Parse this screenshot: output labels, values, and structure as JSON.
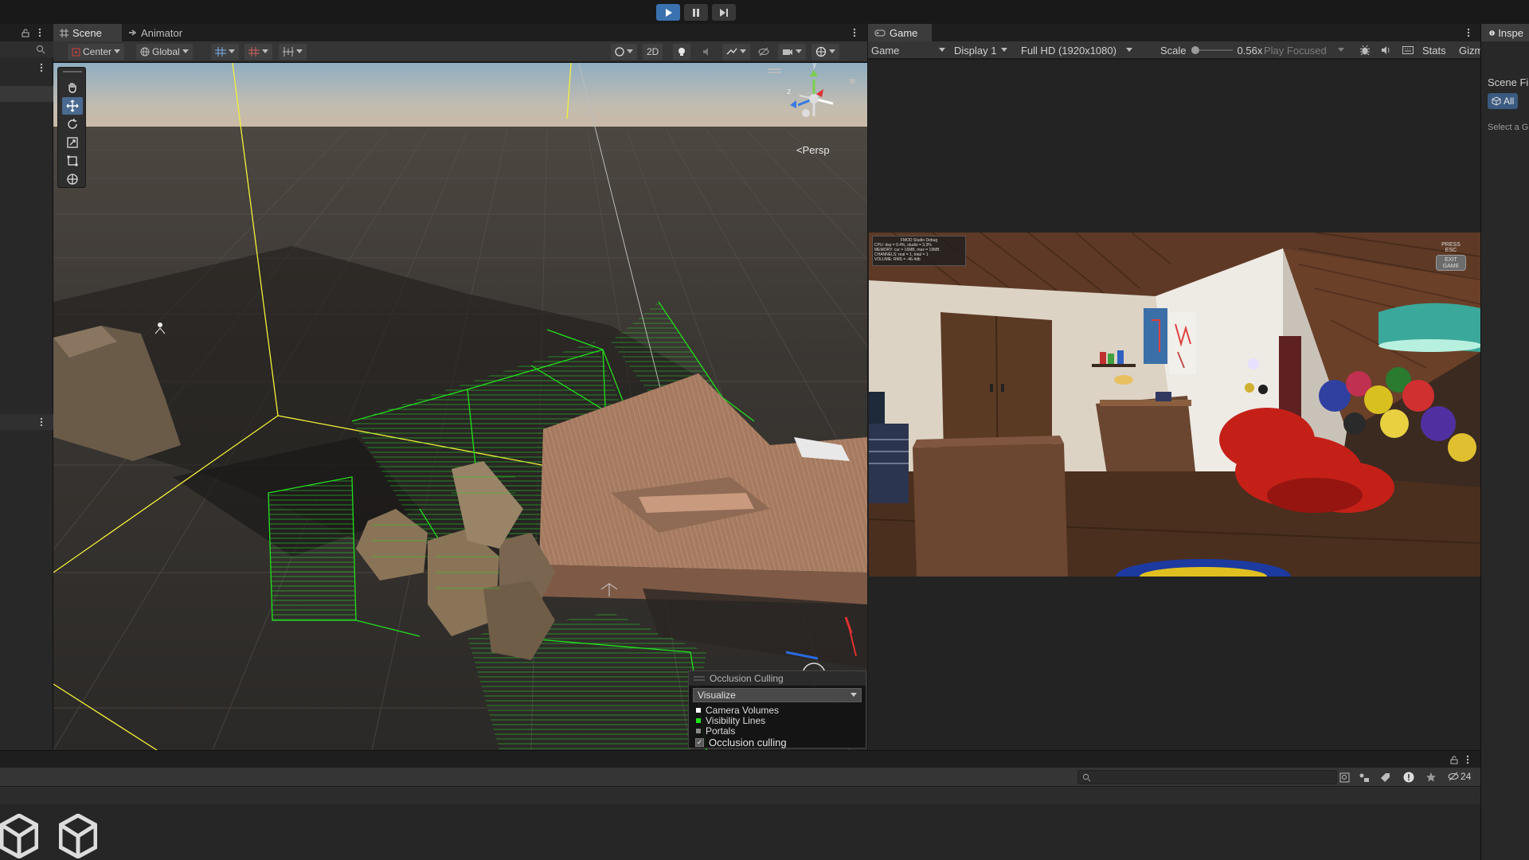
{
  "colors": {
    "accent_play": "#3a72b0",
    "panel": "#282828",
    "toolbar": "#353535",
    "tab_selected": "#3c3c3c",
    "culling_green": "#22e01d",
    "gizmo_yellow": "#f4f03a",
    "camera_volume_color": "#ffffff",
    "visibility_lines_color": "#22e01d",
    "portals_color": "#8a8a8a"
  },
  "playbar": {
    "play_icon": "play-icon",
    "pause_icon": "pause-icon",
    "step_icon": "step-icon"
  },
  "scene_panel": {
    "tabs": [
      {
        "label": "Scene",
        "icon": "grid-icon"
      },
      {
        "label": "Animator",
        "icon": "animator-icon"
      }
    ],
    "toolbar": {
      "pivot": "Center",
      "space": "Global",
      "mode_2d": "2D"
    },
    "orientation_label": "Persp",
    "axis_label_y": "y",
    "axis_label_z": "z",
    "tools": [
      "hand-icon",
      "move-icon",
      "rotate-icon",
      "scale-icon",
      "rect-icon",
      "transform-icon"
    ],
    "occlusion_overlay": {
      "title": "Occlusion Culling",
      "mode": "Visualize",
      "legend": [
        "Camera Volumes",
        "Visibility Lines",
        "Portals"
      ],
      "checkbox_label": "Occlusion culling",
      "checkbox_checked": true
    }
  },
  "game_panel": {
    "tab_label": "Game",
    "toolbar": {
      "view": "Game",
      "display": "Display 1",
      "resolution": "Full HD (1920x1080)",
      "scale_label": "Scale",
      "scale_value": "0.56x",
      "play_mode": "Play Focused",
      "stats": "Stats",
      "gizmos": "Gizm"
    },
    "overlay": {
      "debug_title": "FMOD Studio Debug",
      "debug_lines": [
        "CPU: dsp = 0.4%, studio = 3.3%",
        "MEMORY: cur = 16MB, max = 19MB",
        "CHANNELS: real = 1, total = 1",
        "VOLUME: RMS = -46.4db"
      ],
      "press_esc": "PRESS ESC",
      "exit_game": "EXIT GAME"
    }
  },
  "inspector": {
    "tab_label": "Inspe",
    "scene_filter_label": "Scene Fi",
    "filter_all": "All",
    "hint": "Select a G"
  },
  "console": {
    "search_placeholder": "",
    "hidden_count": "24"
  }
}
